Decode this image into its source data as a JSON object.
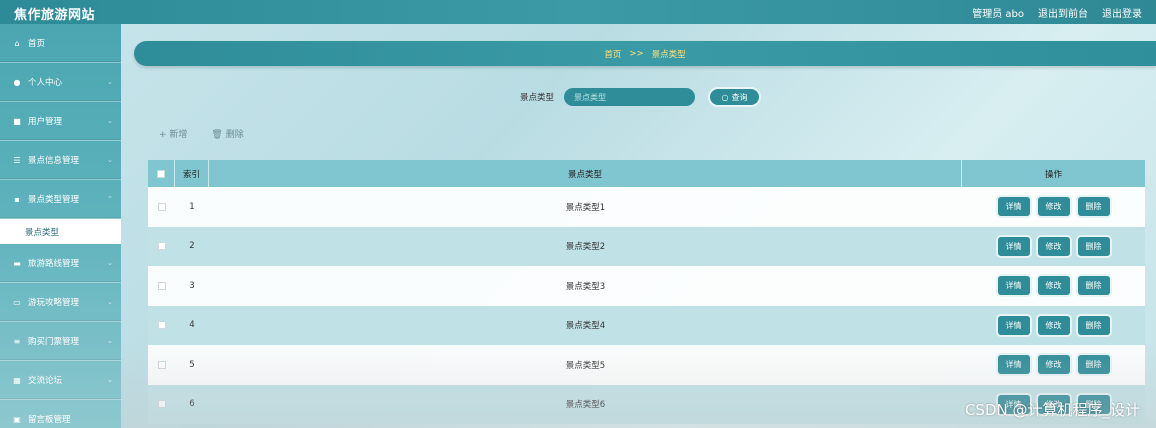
{
  "header": {
    "title": "焦作旅游网站",
    "user": "管理员 abo",
    "back_front": "退出到前台",
    "logout": "退出登录"
  },
  "sidebar": {
    "items": [
      {
        "label": "首页",
        "icon": "home-icon"
      },
      {
        "label": "个人中心",
        "icon": "user-icon"
      },
      {
        "label": "用户管理",
        "icon": "users-icon"
      },
      {
        "label": "景点信息管理",
        "icon": "sliders-icon"
      },
      {
        "label": "景点类型管理",
        "icon": "grid-icon"
      },
      {
        "label": "旅游路线管理",
        "icon": "briefcase-icon"
      },
      {
        "label": "游玩攻略管理",
        "icon": "monitor-icon"
      },
      {
        "label": "购买门票管理",
        "icon": "list-icon"
      },
      {
        "label": "交流论坛",
        "icon": "forum-icon"
      },
      {
        "label": "留言板管理",
        "icon": "message-icon"
      }
    ],
    "active_sub": "景点类型"
  },
  "breadcrumb": {
    "home": "首页",
    "sep": ">>",
    "current": "景点类型"
  },
  "search": {
    "label": "景点类型",
    "placeholder": "景点类型",
    "button": "查询"
  },
  "actions": {
    "add": "+ 新增",
    "delete": "删除"
  },
  "table": {
    "headers": {
      "index": "索引",
      "type": "景点类型",
      "ops": "操作"
    },
    "rows": [
      {
        "index": "1",
        "type": "景点类型1"
      },
      {
        "index": "2",
        "type": "景点类型2"
      },
      {
        "index": "3",
        "type": "景点类型3"
      },
      {
        "index": "4",
        "type": "景点类型4"
      },
      {
        "index": "5",
        "type": "景点类型5"
      },
      {
        "index": "6",
        "type": "景点类型6"
      }
    ],
    "btn_detail": "详情",
    "btn_edit": "修改",
    "btn_delete": "删除"
  },
  "watermark": "CSDN @计算机程序_设计",
  "colors": {
    "primary": "#2e8d99",
    "header": "#7fc6d0",
    "breadcrumb_text": "#ffe37a"
  }
}
